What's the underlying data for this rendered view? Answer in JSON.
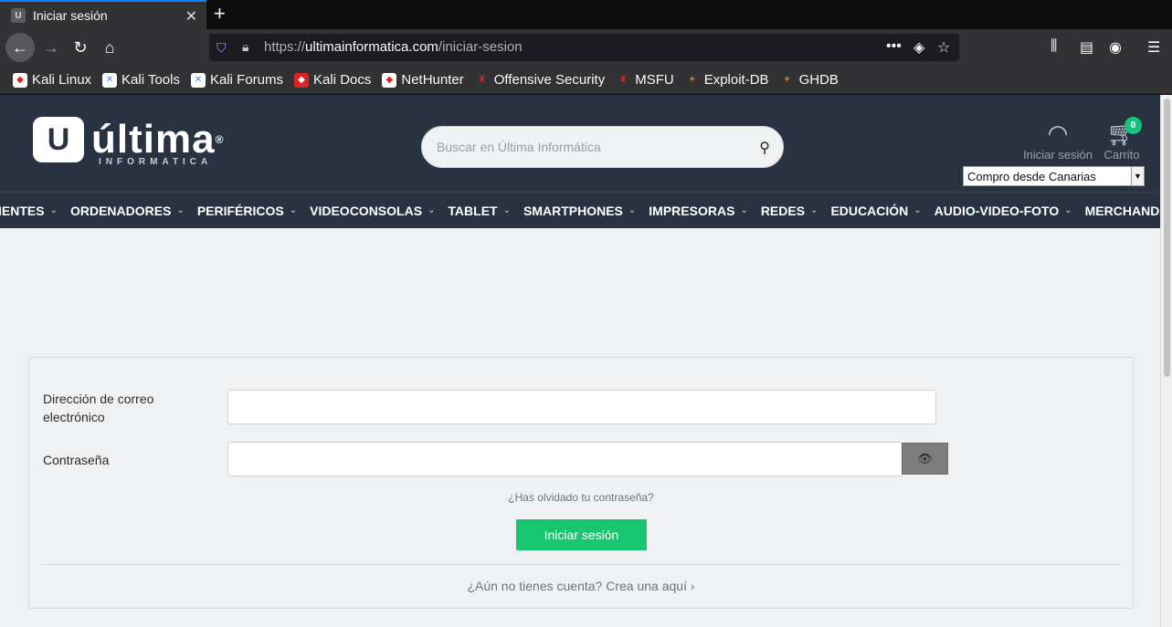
{
  "browser": {
    "tab_title": "Iniciar sesión",
    "tab_close": "✕",
    "new_tab": "+",
    "url_scheme": "https://",
    "url_host": "ultimainformatica.com",
    "url_path": "/iniciar-sesion",
    "bookmarks": [
      {
        "label": "Kali Linux",
        "icon": "kali-icon",
        "color": "#d22"
      },
      {
        "label": "Kali Tools",
        "icon": "kali-tools-icon",
        "color": "#3a8ee6"
      },
      {
        "label": "Kali Forums",
        "icon": "kali-forums-icon",
        "color": "#3a8ee6"
      },
      {
        "label": "Kali Docs",
        "icon": "kali-docs-icon",
        "color": "#d22"
      },
      {
        "label": "NetHunter",
        "icon": "nethunter-icon",
        "color": "#d22"
      },
      {
        "label": "Offensive Security",
        "icon": "offsec-icon",
        "color": "#d22"
      },
      {
        "label": "MSFU",
        "icon": "msfu-icon",
        "color": "#d22"
      },
      {
        "label": "Exploit-DB",
        "icon": "exploit-db-icon",
        "color": "#e08a1e"
      },
      {
        "label": "GHDB",
        "icon": "ghdb-icon",
        "color": "#e08a1e"
      }
    ]
  },
  "site": {
    "logo_mark": "U",
    "logo_name": "última",
    "logo_reg": "®",
    "logo_sub": "INFORMATICA",
    "search_placeholder": "Buscar en Última Informática",
    "account_label": "Iniciar sesión",
    "cart_label": "Carrito",
    "cart_count": "0",
    "region": "Compro desde Canarias",
    "menu": [
      "IENTES",
      "ORDENADORES",
      "PERIFÉRICOS",
      "VIDEOCONSOLAS",
      "TABLET",
      "SMARTPHONES",
      "IMPRESORAS",
      "REDES",
      "EDUCACIÓN",
      "AUDIO-VIDEO-FOTO",
      "MERCHANDASING"
    ]
  },
  "login": {
    "email_label": "Dirección de correo electrónico",
    "email_value": "",
    "password_label": "Contraseña",
    "password_value": "",
    "forgot_link": "¿Has olvidado tu contraseña?",
    "submit": "Iniciar sesión",
    "register_link": "¿Aún no tienes cuenta? Crea una aquí",
    "accent_color": "#17c66f"
  }
}
